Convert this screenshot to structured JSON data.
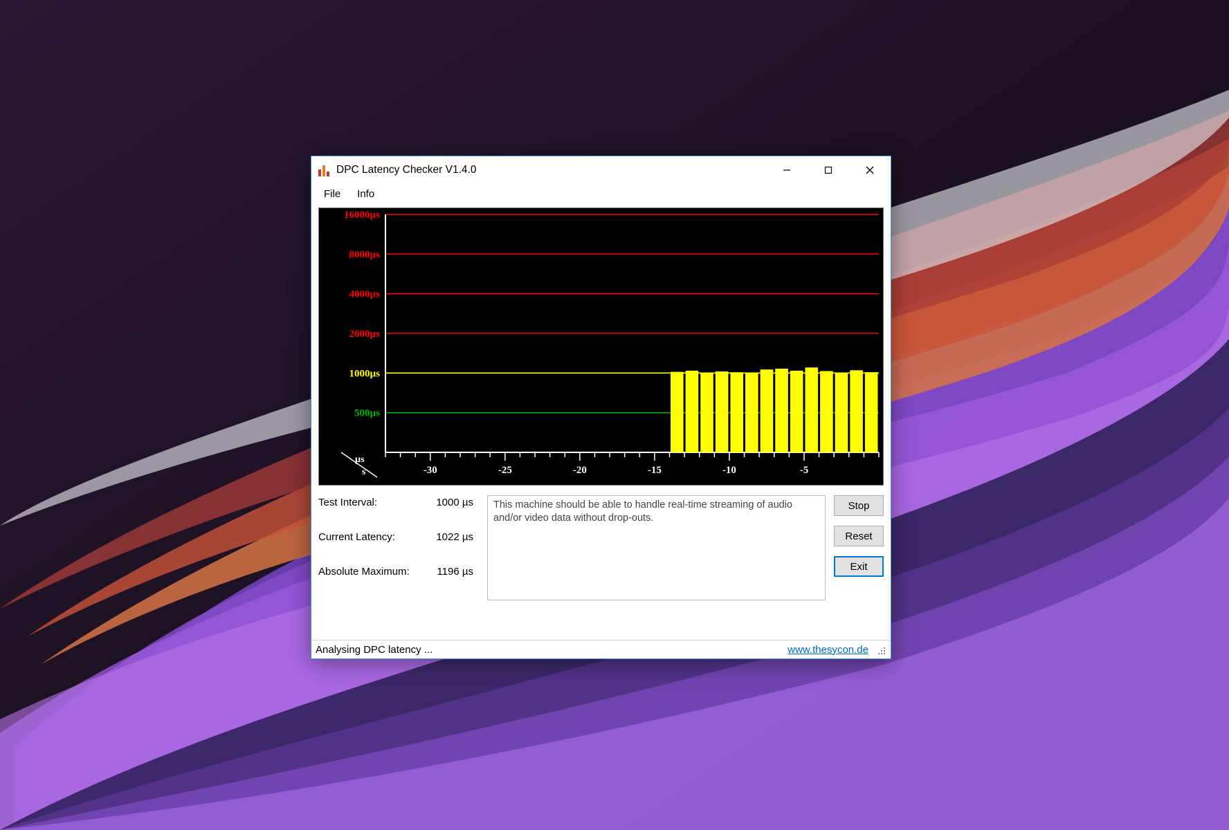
{
  "window": {
    "title": "DPC Latency Checker V1.4.0"
  },
  "menu": {
    "file": "File",
    "info": "Info"
  },
  "stats": {
    "test_interval_label": "Test Interval:",
    "test_interval_value": "1000 µs",
    "current_latency_label": "Current Latency:",
    "current_latency_value": "1022 µs",
    "absolute_max_label": "Absolute Maximum:",
    "absolute_max_value": "1196 µs"
  },
  "message": "This machine should be able to handle real-time streaming of audio and/or video data without drop-outs.",
  "buttons": {
    "stop": "Stop",
    "reset": "Reset",
    "exit": "Exit"
  },
  "statusbar": {
    "text": "Analysing DPC latency ...",
    "link": "www.thesycon.de"
  },
  "chart_data": {
    "type": "bar",
    "ylabel": "µs",
    "xlabel": "s",
    "y_ticks": [
      {
        "v": 500,
        "label": "500µs",
        "color": "#00b400"
      },
      {
        "v": 1000,
        "label": "1000µs",
        "color": "#ffff00"
      },
      {
        "v": 2000,
        "label": "2000µs",
        "color": "#ff0000"
      },
      {
        "v": 4000,
        "label": "4000µs",
        "color": "#ff0000"
      },
      {
        "v": 8000,
        "label": "8000µs",
        "color": "#ff0000"
      },
      {
        "v": 16000,
        "label": "16000µs",
        "color": "#ff0000"
      }
    ],
    "x_ticks": [
      -30,
      -25,
      -20,
      -15,
      -10,
      -5
    ],
    "bars": [
      {
        "x": -14,
        "v": 1030
      },
      {
        "x": -13,
        "v": 1060
      },
      {
        "x": -12,
        "v": 1000
      },
      {
        "x": -11,
        "v": 1040
      },
      {
        "x": -10,
        "v": 1020
      },
      {
        "x": -9,
        "v": 1000
      },
      {
        "x": -8,
        "v": 1090
      },
      {
        "x": -7,
        "v": 1110
      },
      {
        "x": -6,
        "v": 1060
      },
      {
        "x": -5,
        "v": 1140
      },
      {
        "x": -4,
        "v": 1050
      },
      {
        "x": -3,
        "v": 1000
      },
      {
        "x": -2,
        "v": 1070
      },
      {
        "x": -1,
        "v": 1022
      }
    ],
    "bar_color": "#ffff00"
  }
}
